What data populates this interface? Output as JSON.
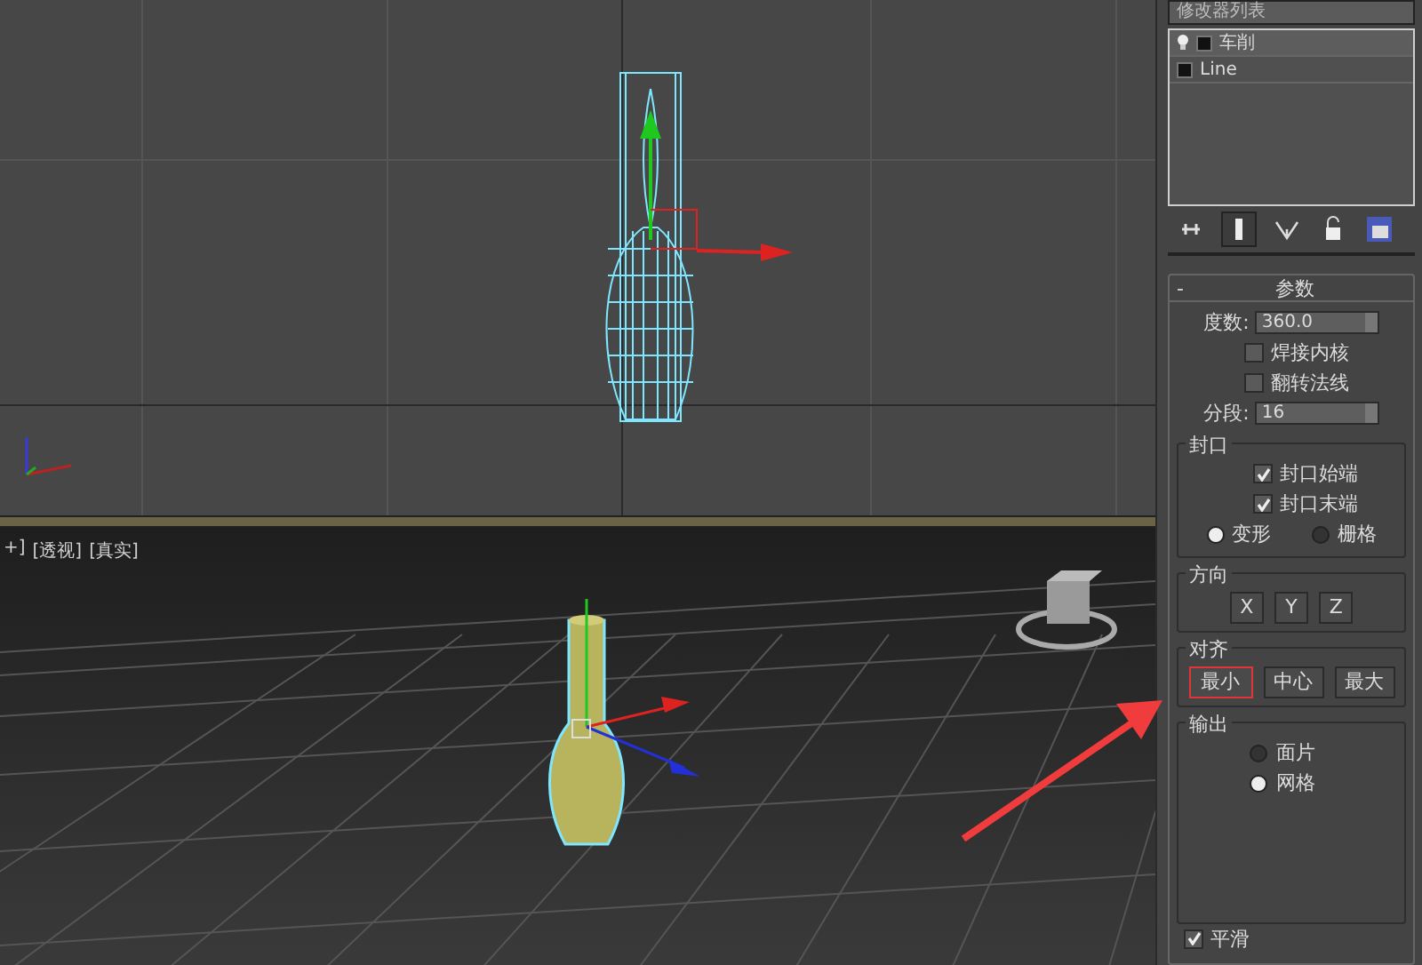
{
  "modifier_list": {
    "label": "修改器列表"
  },
  "modifier_stack": [
    {
      "label": "车削",
      "kind": "modifier",
      "selected": true
    },
    {
      "label": "Line",
      "kind": "base",
      "selected": false
    }
  ],
  "parameters": {
    "collapse": "-",
    "title": "参数",
    "degrees": {
      "label": "度数:",
      "value": "360.0"
    },
    "weld_core": {
      "label": "焊接内核",
      "checked": false
    },
    "flip_normals": {
      "label": "翻转法线",
      "checked": false
    },
    "segments": {
      "label": "分段:",
      "value": "16"
    },
    "capping": {
      "title": "封口",
      "cap_start": {
        "label": "封口始端",
        "checked": true
      },
      "cap_end": {
        "label": "封口末端",
        "checked": true
      },
      "options": [
        {
          "label": "变形",
          "selected": true
        },
        {
          "label": "栅格",
          "selected": false
        }
      ]
    },
    "direction": {
      "title": "方向",
      "buttons": [
        "X",
        "Y",
        "Z"
      ]
    },
    "align": {
      "title": "对齐",
      "buttons": [
        {
          "label": "最小",
          "highlighted": true
        },
        {
          "label": "中心",
          "highlighted": false
        },
        {
          "label": "最大",
          "highlighted": false
        }
      ]
    },
    "output": {
      "title": "输出",
      "options": [
        {
          "label": "面片",
          "selected": false
        },
        {
          "label": "网格",
          "selected": true
        }
      ]
    },
    "smooth": {
      "label": "平滑",
      "checked": true
    }
  },
  "perspective_viewport": {
    "labels": [
      "+]",
      "[透视]",
      "[真实]"
    ]
  }
}
